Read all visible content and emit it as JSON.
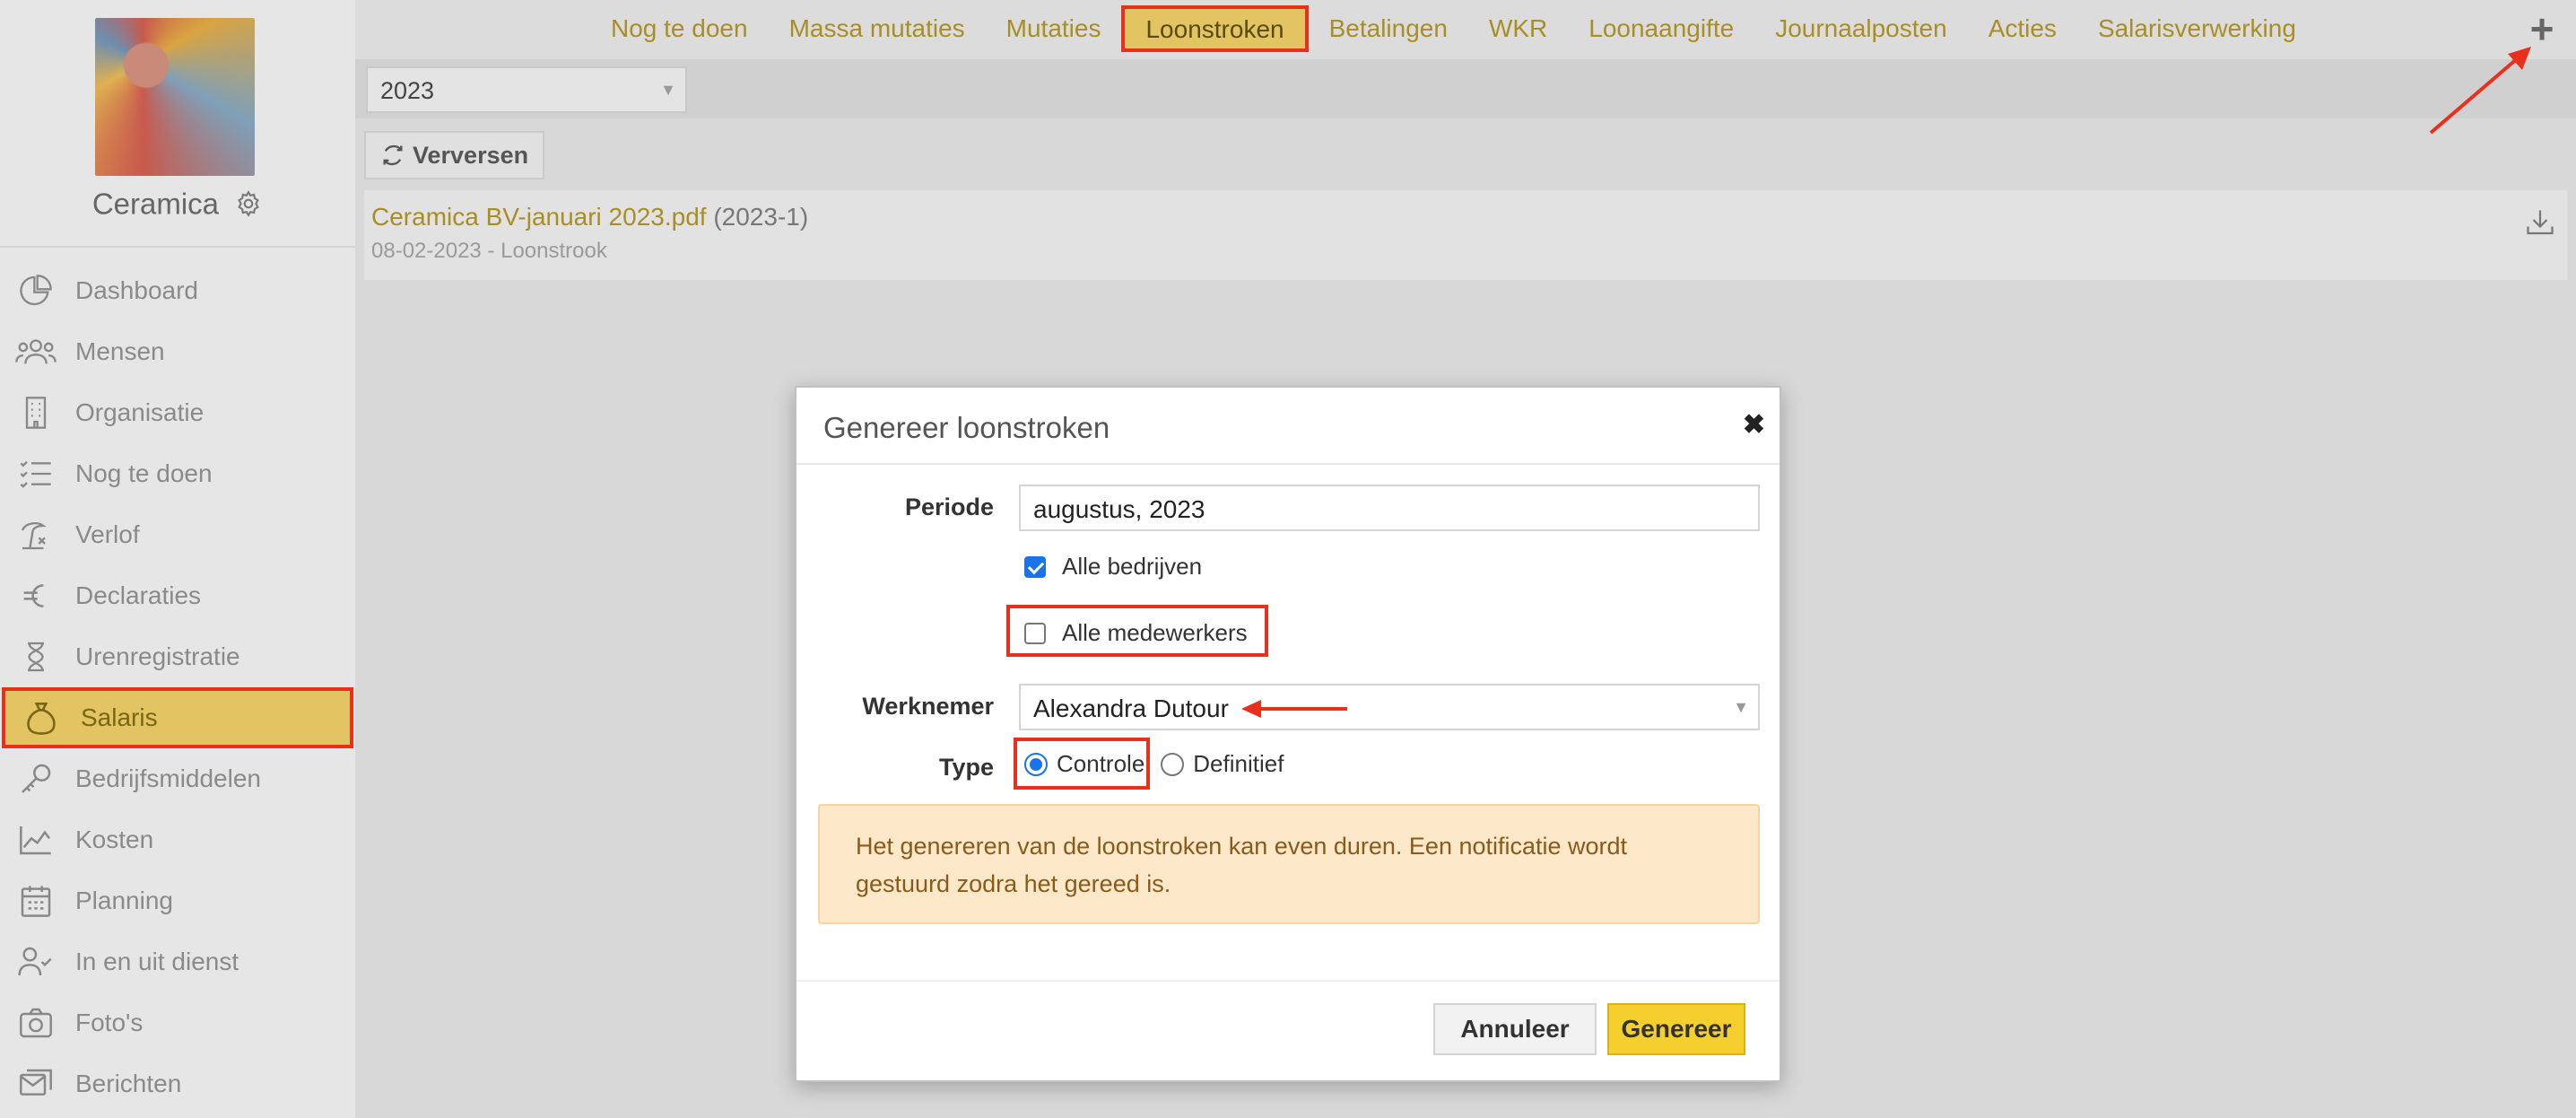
{
  "brand": {
    "name": "Ceramica"
  },
  "sidebar": {
    "items": [
      {
        "label": "Dashboard",
        "icon": "pie-chart-icon"
      },
      {
        "label": "Mensen",
        "icon": "people-icon"
      },
      {
        "label": "Organisatie",
        "icon": "building-icon"
      },
      {
        "label": "Nog te doen",
        "icon": "checklist-icon"
      },
      {
        "label": "Verlof",
        "icon": "beach-icon"
      },
      {
        "label": "Declaraties",
        "icon": "euro-icon"
      },
      {
        "label": "Urenregistratie",
        "icon": "hourglass-icon"
      },
      {
        "label": "Salaris",
        "icon": "money-bag-icon",
        "active": true
      },
      {
        "label": "Bedrijfsmiddelen",
        "icon": "key-icon"
      },
      {
        "label": "Kosten",
        "icon": "chart-icon"
      },
      {
        "label": "Planning",
        "icon": "calendar-icon"
      },
      {
        "label": "In en uit dienst",
        "icon": "user-check-icon"
      },
      {
        "label": "Foto's",
        "icon": "camera-icon"
      },
      {
        "label": "Berichten",
        "icon": "messages-icon"
      }
    ]
  },
  "tabs": [
    {
      "label": "Nog te doen"
    },
    {
      "label": "Massa mutaties"
    },
    {
      "label": "Mutaties"
    },
    {
      "label": "Loonstroken",
      "active": true
    },
    {
      "label": "Betalingen"
    },
    {
      "label": "WKR"
    },
    {
      "label": "Loonaangifte"
    },
    {
      "label": "Journaalposten"
    },
    {
      "label": "Acties"
    },
    {
      "label": "Salarisverwerking"
    }
  ],
  "toolbar": {
    "year": "2023",
    "refresh_label": "Verversen",
    "add_symbol": "+"
  },
  "document": {
    "title": "Ceramica BV-januari 2023.pdf",
    "period": "(2023-1)",
    "subtitle": "08-02-2023 - Loonstrook"
  },
  "modal": {
    "title": "Genereer loonstroken",
    "close_symbol": "✖",
    "periode_label": "Periode",
    "periode_value": "augustus, 2023",
    "alle_bedrijven_label": "Alle bedrijven",
    "alle_bedrijven_checked": true,
    "alle_medewerkers_label": "Alle medewerkers",
    "alle_medewerkers_checked": false,
    "werknemer_label": "Werknemer",
    "werknemer_value": "Alexandra Dutour",
    "type_label": "Type",
    "type_options": [
      "Controle",
      "Definitief"
    ],
    "type_selected": "Controle",
    "alert_text": "Het genereren van de loonstroken kan even duren. Een notificatie wordt gestuurd zodra het gereed is.",
    "cancel_label": "Annuleer",
    "submit_label": "Genereer"
  },
  "colors": {
    "accent": "#e2c462",
    "link": "#a88e24",
    "highlight": "#e8301c",
    "primary_button": "#f4cf2d",
    "alert_bg": "#fde9c9"
  }
}
